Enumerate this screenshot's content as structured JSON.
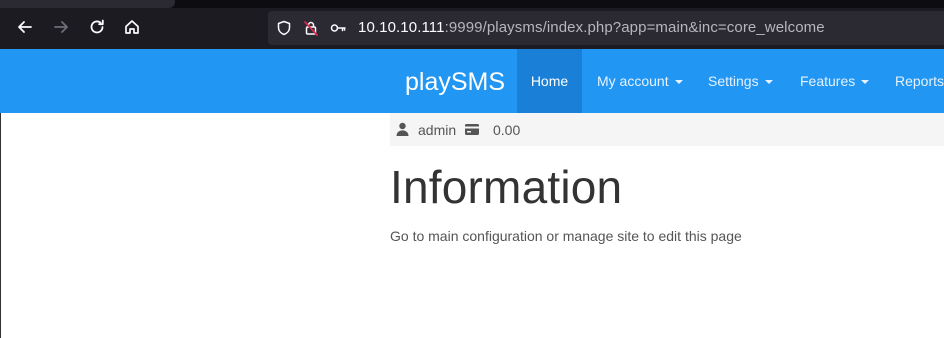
{
  "browser": {
    "url_host": "10.10.10.111",
    "url_rest": ":9999/playsms/index.php?app=main&inc=core_welcome"
  },
  "navbar": {
    "brand": "playSMS",
    "items": [
      {
        "label": "Home",
        "active": true
      },
      {
        "label": "My account",
        "dropdown": true
      },
      {
        "label": "Settings",
        "dropdown": true
      },
      {
        "label": "Features",
        "dropdown": true
      },
      {
        "label": "Reports",
        "dropdown": false
      }
    ],
    "color": "#2196f3",
    "active_color": "#1a7fd6"
  },
  "userbar": {
    "username": "admin",
    "credit": "0.00",
    "icons": [
      "user-icon",
      "credit-card-icon"
    ]
  },
  "content": {
    "title": "Information",
    "description": "Go to main configuration or manage site to edit this page"
  }
}
